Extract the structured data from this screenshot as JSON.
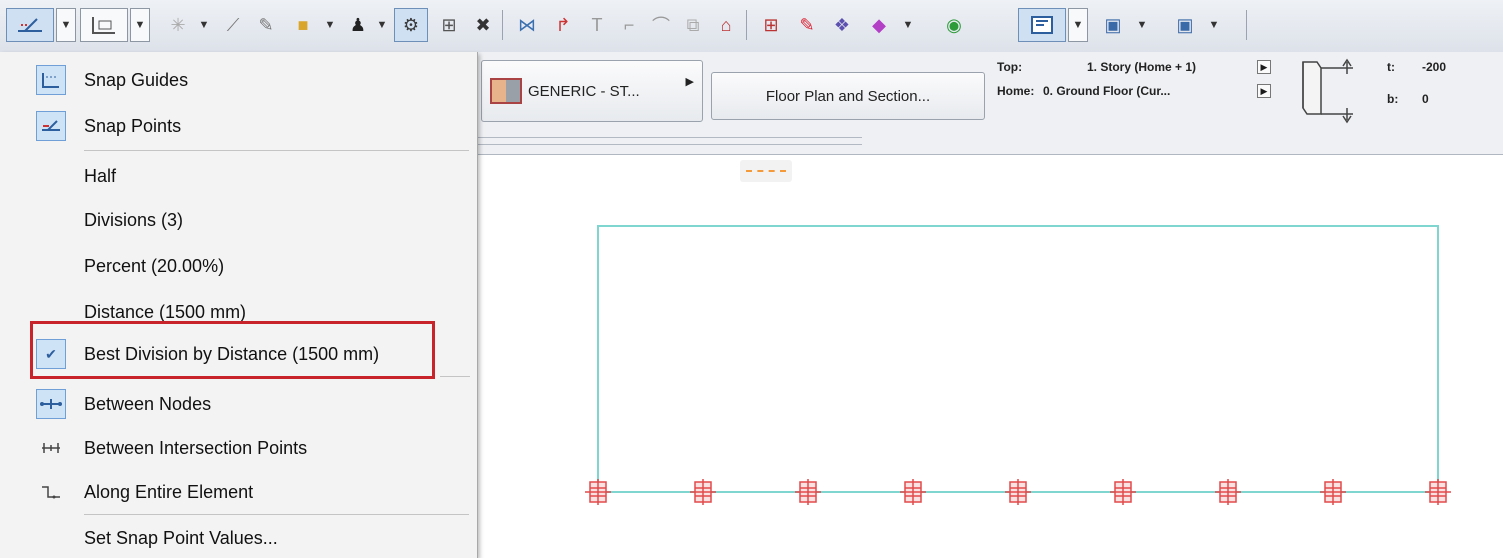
{
  "toolbar": {
    "icons": [
      "snap-points-icon",
      "chevron-down-icon",
      "snap-guides-icon",
      "chevron-down-icon",
      "asterisk-icon",
      "chevron-down-icon",
      "line-icon",
      "pencil-icon",
      "cube-icon",
      "chevron-down-icon",
      "figure-icon",
      "chevron-down-icon",
      "trace-icon",
      "grid-icon",
      "cross-icon",
      "align-icon",
      "arrow-icon",
      "text-icon",
      "corner-icon",
      "arc-icon",
      "layers-icon",
      "house-icon",
      "floorplan-icon",
      "brush-icon",
      "shapes-icon",
      "paint-icon",
      "chevron-down-icon",
      "radio-icon",
      "view-icon",
      "chevron-down-icon",
      "camera-icon",
      "chevron-down-icon",
      "window-icon",
      "chevron-down-icon"
    ]
  },
  "menu": {
    "items": [
      {
        "label": "Snap Guides",
        "icon": "snap-guides-icon"
      },
      {
        "label": "Snap Points",
        "icon": "snap-points-icon"
      },
      {
        "label": "Half",
        "icon": ""
      },
      {
        "label": "Divisions (3)",
        "icon": ""
      },
      {
        "label": "Percent (20.00%)",
        "icon": ""
      },
      {
        "label": "Distance (1500 mm)",
        "icon": ""
      },
      {
        "label": "Best Division by Distance (1500 mm)",
        "icon": "check-icon",
        "checked": true
      },
      {
        "label": "Between Nodes",
        "icon": "between-nodes-icon"
      },
      {
        "label": "Between Intersection Points",
        "icon": "between-intersections-icon"
      },
      {
        "label": "Along Entire Element",
        "icon": "along-element-icon"
      },
      {
        "label": "Set Snap Point Values...",
        "icon": ""
      }
    ]
  },
  "infobar": {
    "composite_label": "GENERIC - ST...",
    "floor_plan_label": "Floor Plan and Section...",
    "top_key": "Top:",
    "top_value": "1. Story (Home + 1)",
    "home_key": "Home:",
    "home_value": "0. Ground Floor (Cur...",
    "t_key": "t:",
    "t_value": "-200",
    "b_key": "b:",
    "b_value": "0"
  },
  "canvas": {
    "outline_color": "#7fd6d0",
    "node_color": "#e24a4a",
    "snap_point_count": 9
  }
}
